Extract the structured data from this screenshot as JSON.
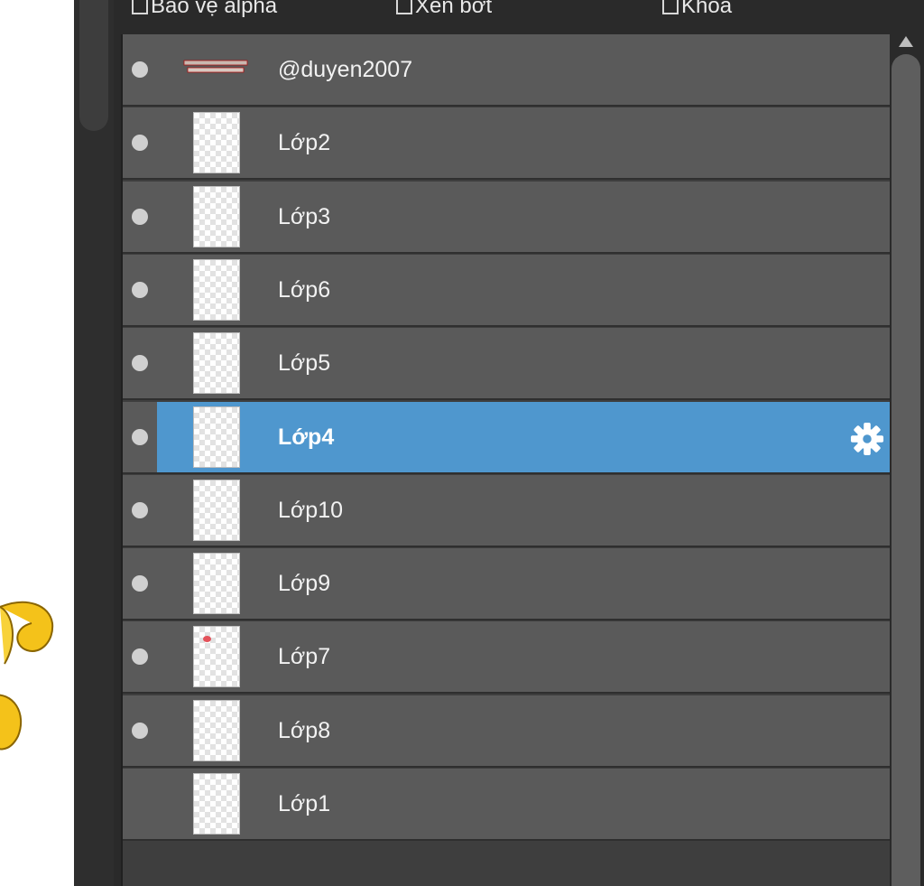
{
  "options": [
    {
      "label": "Bảo vệ alpha",
      "checked": false
    },
    {
      "label": "Xén bớt",
      "checked": false
    },
    {
      "label": "Khóa",
      "checked": false
    }
  ],
  "layers": [
    {
      "name": "@duyen2007",
      "visible": true,
      "thumb": "text",
      "selected": false
    },
    {
      "name": "Lớp2",
      "visible": true,
      "thumb": "empty",
      "selected": false
    },
    {
      "name": "Lớp3",
      "visible": true,
      "thumb": "empty",
      "selected": false
    },
    {
      "name": "Lớp6",
      "visible": true,
      "thumb": "empty",
      "selected": false
    },
    {
      "name": "Lớp5",
      "visible": true,
      "thumb": "empty",
      "selected": false
    },
    {
      "name": "Lớp4",
      "visible": true,
      "thumb": "empty",
      "selected": true
    },
    {
      "name": "Lớp10",
      "visible": true,
      "thumb": "empty",
      "selected": false
    },
    {
      "name": "Lớp9",
      "visible": true,
      "thumb": "empty",
      "selected": false
    },
    {
      "name": "Lớp7",
      "visible": true,
      "thumb": "red-dot",
      "selected": false
    },
    {
      "name": "Lớp8",
      "visible": true,
      "thumb": "empty",
      "selected": false
    },
    {
      "name": "Lớp1",
      "visible": false,
      "thumb": "empty",
      "selected": false
    }
  ],
  "colors": {
    "row": "#5a5a5a",
    "selected": "#4f97ce",
    "panel": "#2a2a2a"
  },
  "icons": {
    "settings": "gear-icon",
    "visibility": "eye-dot-icon",
    "scroll_up": "arrow-up-icon"
  }
}
